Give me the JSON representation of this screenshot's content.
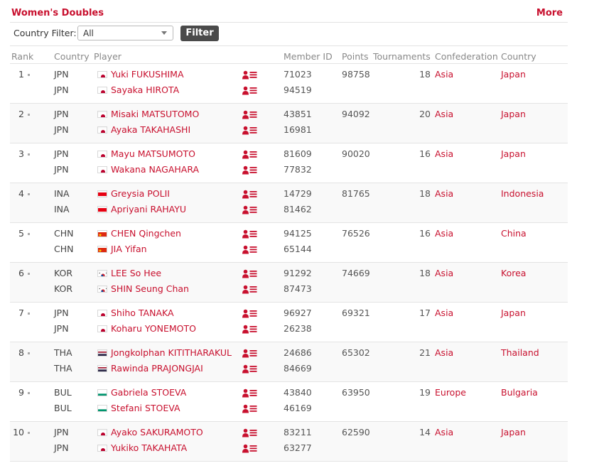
{
  "header": {
    "title": "Women's Doubles",
    "more": "More"
  },
  "filter": {
    "label": "Country Filter:",
    "selected": "All",
    "button": "Filter"
  },
  "columns": {
    "rank": "Rank",
    "country": "Country",
    "player": "Player",
    "member_id": "Member ID",
    "points": "Points",
    "tournaments": "Tournaments",
    "confederation": "Confederation",
    "country_name": "Country"
  },
  "icons": {
    "flag": "flag-icon",
    "profile": "player-profile-icon"
  },
  "colors": {
    "accent": "#c8102e",
    "button": "#4a4a4a"
  },
  "rows": [
    {
      "rank": "1",
      "points": "98758",
      "tournaments": "18",
      "confederation": "Asia",
      "country": "Japan",
      "players": [
        {
          "code": "JPN",
          "flag": "jpn",
          "name": "Yuki FUKUSHIMA",
          "id": "71023"
        },
        {
          "code": "JPN",
          "flag": "jpn",
          "name": "Sayaka HIROTA",
          "id": "94519"
        }
      ]
    },
    {
      "rank": "2",
      "points": "94092",
      "tournaments": "20",
      "confederation": "Asia",
      "country": "Japan",
      "players": [
        {
          "code": "JPN",
          "flag": "jpn",
          "name": "Misaki MATSUTOMO",
          "id": "43851"
        },
        {
          "code": "JPN",
          "flag": "jpn",
          "name": "Ayaka TAKAHASHI",
          "id": "16981"
        }
      ]
    },
    {
      "rank": "3",
      "points": "90020",
      "tournaments": "16",
      "confederation": "Asia",
      "country": "Japan",
      "players": [
        {
          "code": "JPN",
          "flag": "jpn",
          "name": "Mayu MATSUMOTO",
          "id": "81609"
        },
        {
          "code": "JPN",
          "flag": "jpn",
          "name": "Wakana NAGAHARA",
          "id": "77832"
        }
      ]
    },
    {
      "rank": "4",
      "points": "81765",
      "tournaments": "18",
      "confederation": "Asia",
      "country": "Indonesia",
      "players": [
        {
          "code": "INA",
          "flag": "ina",
          "name": "Greysia POLII",
          "id": "14729"
        },
        {
          "code": "INA",
          "flag": "ina",
          "name": "Apriyani RAHAYU",
          "id": "81462"
        }
      ]
    },
    {
      "rank": "5",
      "points": "76526",
      "tournaments": "16",
      "confederation": "Asia",
      "country": "China",
      "players": [
        {
          "code": "CHN",
          "flag": "chn",
          "name": "CHEN Qingchen",
          "id": "94125"
        },
        {
          "code": "CHN",
          "flag": "chn",
          "name": "JIA Yifan",
          "id": "65144"
        }
      ]
    },
    {
      "rank": "6",
      "points": "74669",
      "tournaments": "18",
      "confederation": "Asia",
      "country": "Korea",
      "players": [
        {
          "code": "KOR",
          "flag": "kor",
          "name": "LEE So Hee",
          "id": "91292"
        },
        {
          "code": "KOR",
          "flag": "kor",
          "name": "SHIN Seung Chan",
          "id": "87473"
        }
      ]
    },
    {
      "rank": "7",
      "points": "69321",
      "tournaments": "17",
      "confederation": "Asia",
      "country": "Japan",
      "players": [
        {
          "code": "JPN",
          "flag": "jpn",
          "name": "Shiho TANAKA",
          "id": "96927"
        },
        {
          "code": "JPN",
          "flag": "jpn",
          "name": "Koharu YONEMOTO",
          "id": "26238"
        }
      ]
    },
    {
      "rank": "8",
      "points": "65302",
      "tournaments": "21",
      "confederation": "Asia",
      "country": "Thailand",
      "players": [
        {
          "code": "THA",
          "flag": "tha",
          "name": "Jongkolphan KITITHARAKUL",
          "id": "24686"
        },
        {
          "code": "THA",
          "flag": "tha",
          "name": "Rawinda PRAJONGJAI",
          "id": "84669"
        }
      ]
    },
    {
      "rank": "9",
      "points": "63950",
      "tournaments": "19",
      "confederation": "Europe",
      "country": "Bulgaria",
      "players": [
        {
          "code": "BUL",
          "flag": "bul",
          "name": "Gabriela STOEVA",
          "id": "43840"
        },
        {
          "code": "BUL",
          "flag": "bul",
          "name": "Stefani STOEVA",
          "id": "46169"
        }
      ]
    },
    {
      "rank": "10",
      "points": "62590",
      "tournaments": "14",
      "confederation": "Asia",
      "country": "Japan",
      "players": [
        {
          "code": "JPN",
          "flag": "jpn",
          "name": "Ayako SAKURAMOTO",
          "id": "83211"
        },
        {
          "code": "JPN",
          "flag": "jpn",
          "name": "Yukiko TAKAHATA",
          "id": "63277"
        }
      ]
    }
  ]
}
